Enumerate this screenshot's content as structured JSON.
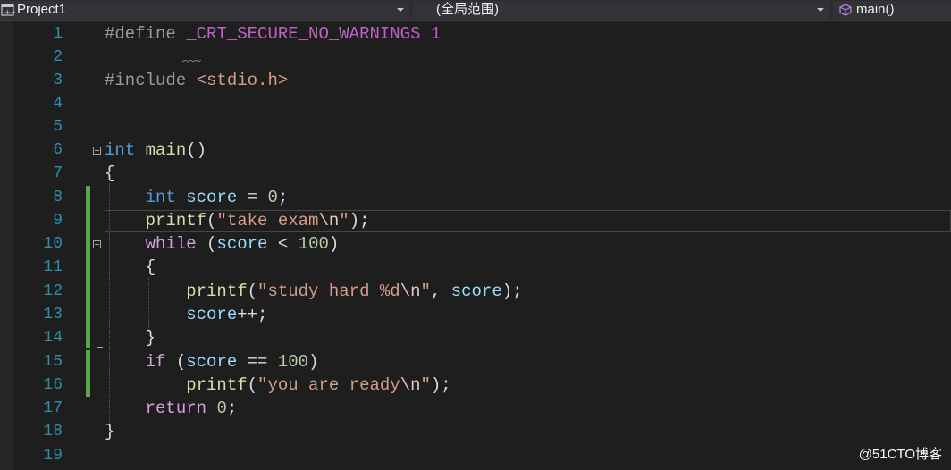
{
  "navbar": {
    "project": {
      "label": "Project1",
      "icon": "cpp-project-icon"
    },
    "scope": {
      "label": "(全局范围)"
    },
    "member": {
      "label": "main()",
      "icon": "method-cube-icon"
    }
  },
  "editor": {
    "line_numbers": [
      "1",
      "2",
      "3",
      "4",
      "5",
      "6",
      "7",
      "8",
      "9",
      "10",
      "11",
      "12",
      "13",
      "14",
      "15",
      "16",
      "17",
      "18",
      "19"
    ],
    "lines": [
      [
        "#define",
        " ",
        "_CRT_SECURE_NO_WARNINGS",
        " ",
        "1"
      ],
      [],
      [
        "#include",
        " ",
        "<stdio.h>"
      ],
      [],
      [],
      [
        "int",
        " ",
        "main",
        "()"
      ],
      [
        "{"
      ],
      [
        "    ",
        "int",
        " ",
        "score",
        " = ",
        "0",
        ";"
      ],
      [
        "    ",
        "printf",
        "(",
        "\"take exam",
        "\\n",
        "\"",
        ");"
      ],
      [
        "    ",
        "while",
        " (",
        "score",
        " < ",
        "100",
        ")"
      ],
      [
        "    {"
      ],
      [
        "        ",
        "printf",
        "(",
        "\"study hard %d",
        "\\n",
        "\"",
        ", ",
        "score",
        ");"
      ],
      [
        "        ",
        "score",
        "++;"
      ],
      [
        "    }"
      ],
      [
        "    ",
        "if",
        " (",
        "score",
        " == ",
        "100",
        ")"
      ],
      [
        "        ",
        "printf",
        "(",
        "\"you are ready",
        "\\n",
        "\"",
        ");"
      ],
      [
        "    ",
        "return",
        " ",
        "0",
        ";"
      ],
      [
        "}"
      ],
      []
    ]
  },
  "colors": {
    "editor_bg": "#1e1e1e",
    "keyword": "#569cd6",
    "string": "#d69d85",
    "number": "#b5cea8",
    "function": "#dcdcaa",
    "variable": "#9cdcfe",
    "line_number": "#2b91af",
    "change_bar": "#57a64a"
  },
  "watermark": "@51CTO博客"
}
